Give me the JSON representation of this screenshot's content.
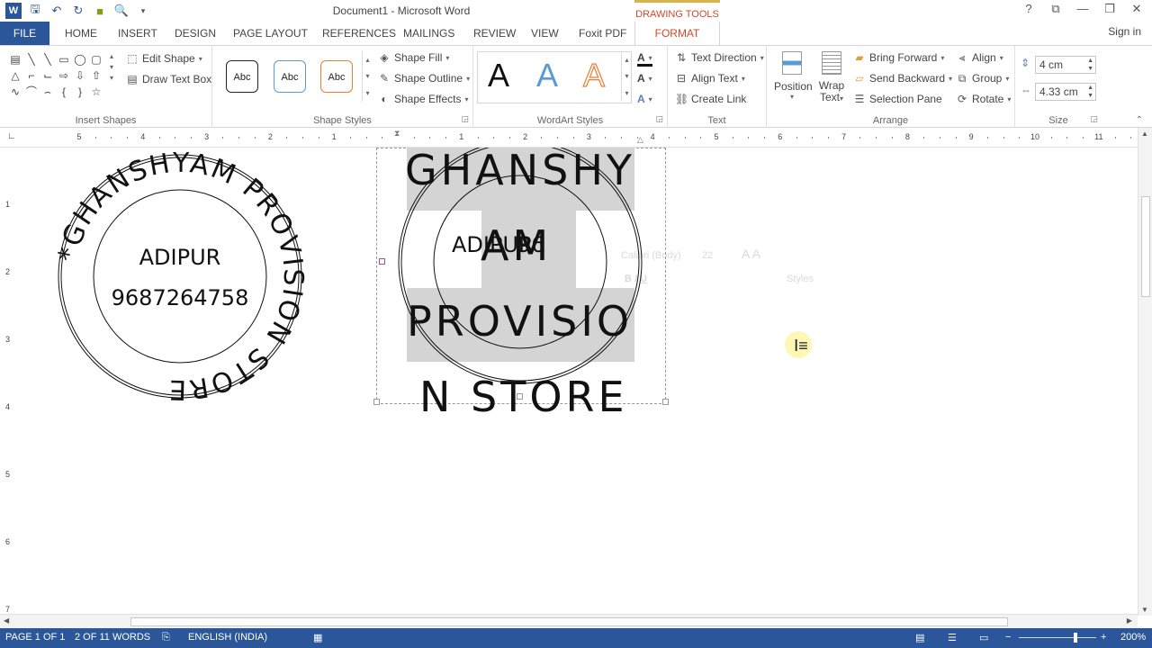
{
  "window": {
    "title": "Document1 - Microsoft Word",
    "context_tab_group": "DRAWING TOOLS",
    "sign_in": "Sign in",
    "controls": [
      "?",
      "⧉",
      "—",
      "❐",
      "✕"
    ]
  },
  "tabs": [
    {
      "label": "FILE"
    },
    {
      "label": "HOME"
    },
    {
      "label": "INSERT"
    },
    {
      "label": "DESIGN"
    },
    {
      "label": "PAGE LAYOUT"
    },
    {
      "label": "REFERENCES"
    },
    {
      "label": "MAILINGS"
    },
    {
      "label": "REVIEW"
    },
    {
      "label": "VIEW"
    },
    {
      "label": "Foxit PDF"
    },
    {
      "label": "FORMAT"
    }
  ],
  "ribbon": {
    "insert_shapes": {
      "label": "Insert Shapes",
      "edit_shape": "Edit Shape",
      "draw_text_box": "Draw Text Box"
    },
    "shape_styles": {
      "label": "Shape Styles",
      "preset": "Abc",
      "shape_fill": "Shape Fill",
      "shape_outline": "Shape Outline",
      "shape_effects": "Shape Effects"
    },
    "wordart_styles": {
      "label": "WordArt Styles",
      "letter": "A"
    },
    "text": {
      "label": "Text",
      "text_direction": "Text Direction",
      "align_text": "Align Text",
      "create_link": "Create Link"
    },
    "arrange": {
      "label": "Arrange",
      "position": "Position",
      "wrap_text_1": "Wrap",
      "wrap_text_2": "Text",
      "bring_forward": "Bring Forward",
      "send_backward": "Send Backward",
      "selection_pane": "Selection Pane",
      "align": "Align",
      "group": "Group",
      "rotate": "Rotate"
    },
    "size": {
      "label": "Size",
      "height": "4 cm",
      "width": "4.33 cm"
    }
  },
  "ruler": {
    "h_numbers": [
      "5",
      "4",
      "3",
      "2",
      "1",
      "",
      "1",
      "2",
      "3",
      "4",
      "5",
      "6",
      "7",
      "8",
      "9",
      "10",
      "11"
    ],
    "v_numbers": [
      "1",
      "2",
      "3",
      "4",
      "5",
      "6",
      "7"
    ]
  },
  "stamp_left": {
    "ring_text": "*GHANSHYAM PROVISION STORE",
    "line1": "ADIPUR",
    "line2": "9687264758"
  },
  "stamp_right": {
    "word1": "GHANSHY",
    "word2": "AM",
    "word3": "PROVISIO",
    "word4": "N STORE",
    "overlap": "ADIPUR",
    "overlap2": "96"
  },
  "mini_toolbar": {
    "font": "Calibri (Body)",
    "size": "22",
    "styles": "Styles"
  },
  "status": {
    "page": "PAGE 1 OF 1",
    "words": "2 OF 11 WORDS",
    "language": "ENGLISH (INDIA)",
    "zoom": "200%"
  },
  "colors": {
    "accent": "#2b579a",
    "context": "#d24726"
  }
}
